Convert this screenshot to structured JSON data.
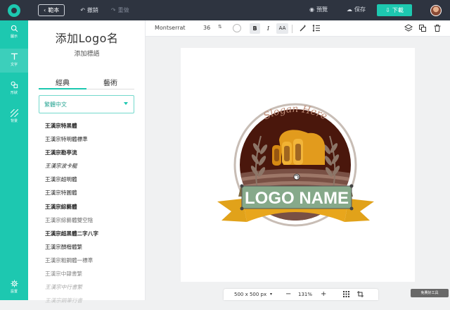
{
  "app": {
    "back_label": "範本",
    "undo_label": "撤銷",
    "redo_label": "重做",
    "preview_label": "預覽",
    "save_label": "保存",
    "download_label": "下載"
  },
  "sidebar": {
    "items": [
      {
        "label": "圖示",
        "icon": "search-icon"
      },
      {
        "label": "文字",
        "icon": "text-icon"
      },
      {
        "label": "形狀",
        "icon": "shapes-icon"
      },
      {
        "label": "背景",
        "icon": "background-pattern-icon"
      },
      {
        "label": "設置",
        "icon": "gear-icon"
      }
    ]
  },
  "panel": {
    "title": "添加Logo名",
    "subtitle": "添加標語",
    "tabs": [
      "經典",
      "藝術"
    ],
    "selected_font": "繁體中文",
    "fonts": [
      "王漢宗特黑體",
      "王漢宗特明體標準",
      "王漢宗勘亭流",
      "王漢宗波卡龍",
      "王漢宗超明體",
      "王漢宗特圓體",
      "王漢宗綜藝體",
      "王漢宗綜藝體雙空陰",
      "王漢宗超黑體二字八字",
      "王漢宗顏楷體繁",
      "王漢宗粗鋼體一標準",
      "王漢宗中隸書繁",
      "王漢宗中行書繁",
      "王漢宗鋼筆行書"
    ]
  },
  "toolbar": {
    "font": "Montserrat",
    "size": "36",
    "bold": "B",
    "italic": "I",
    "case": "AA"
  },
  "logo": {
    "slogan": "Slogan Here",
    "name": "LOGO NAME",
    "colors": {
      "outer_ring": "#c8bdb5",
      "inner_circle": "#4a170c",
      "field": "#8a6657",
      "wheat": "#8d7668",
      "bread": "#e29b1d",
      "ribbon": "#e1a21a",
      "ribbon_dark": "#7e6b43",
      "banner": "#86a98a",
      "slogan_text": "#c08f7a"
    }
  },
  "status": {
    "canvas_size": "500 x 500 px",
    "zoom": "131%",
    "minus": "−",
    "plus": "+",
    "watermark": "免費好工具"
  }
}
